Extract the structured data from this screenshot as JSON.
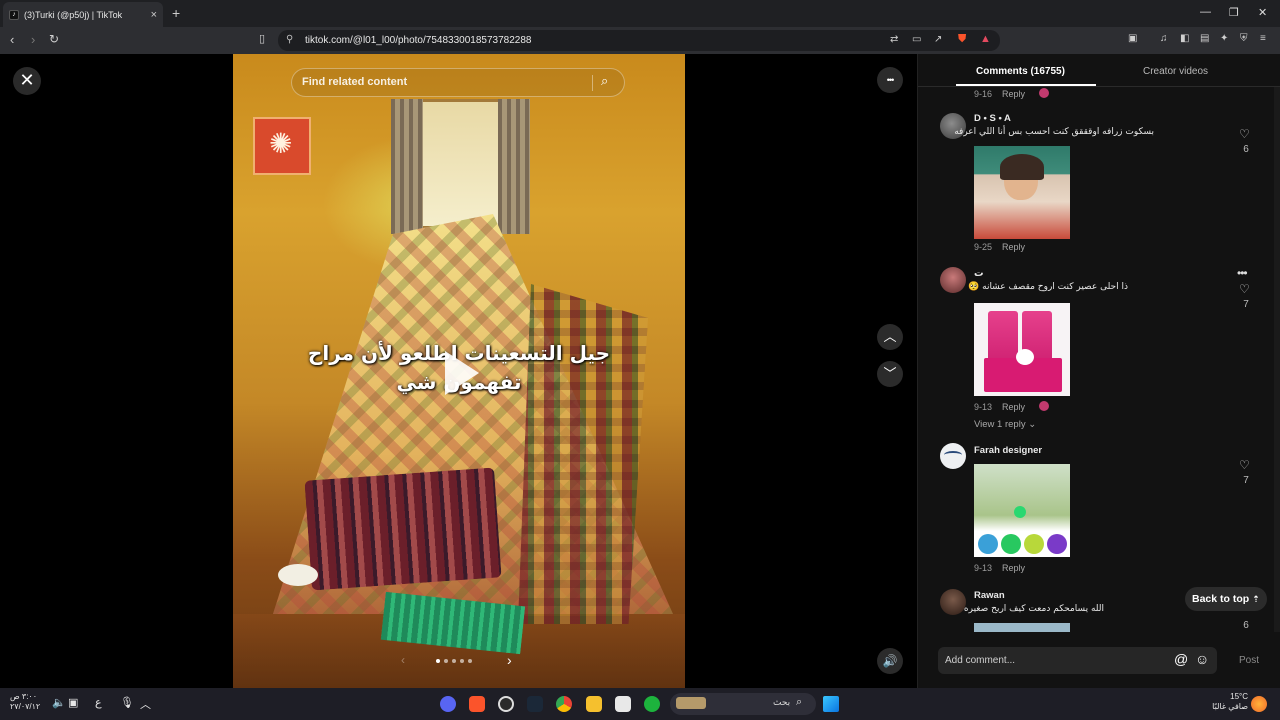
{
  "browser": {
    "tab_title": "(3)Turki (@p50j) | TikTok",
    "new_tab": "+",
    "url": "tiktok.com/@l01_l00/photo/7548330018573782288",
    "window_min": "—",
    "window_max": "❐",
    "window_close": "✕"
  },
  "viewer": {
    "close_label": "✕",
    "search_placeholder": "Find related content",
    "caption_line1": "جيل التسعينات اطلعو لأن مراح",
    "caption_line2": "تفهمون شي",
    "more_label": "•••",
    "slide_count": 5,
    "active_slide": 0
  },
  "panel": {
    "tab_comments": "Comments (16755)",
    "tab_creator": "Creator videos",
    "reply_label": "Reply",
    "top_meta": {
      "date": "9-16"
    },
    "comments": [
      {
        "user": "D • S • A",
        "text": "بسكوت زرافه اوقققق كنت احسب بس أنا اللي اعرفه",
        "date": "9-25",
        "likes": "6"
      },
      {
        "user": "ت",
        "text": "ذا احلى عصير كنت اروح مقصف عشانه 🥺",
        "date": "9-13",
        "likes": "7"
      },
      {
        "user": "Farah designer",
        "text": "",
        "date": "9-13",
        "likes": "7"
      },
      {
        "user": "Rawan",
        "text": "الله يسامحكم دمعت كيف اريح صغيره",
        "date": "",
        "likes": "6"
      }
    ],
    "view_replies": "View 1 reply",
    "back_to_top": "Back to top",
    "add_comment_placeholder": "Add comment...",
    "at_symbol": "@",
    "post_label": "Post"
  },
  "taskbar": {
    "search_text": "بحث",
    "clock_line1": "٣:٠٠ ص",
    "clock_line2": "٢٧/٠٧/١٢",
    "weather_temp": "15°C",
    "weather_desc": "صافي غالبًا",
    "lang": "ع"
  },
  "colors": {
    "accent": "#fe2c55",
    "panel_bg": "#121212",
    "taskbar_bg": "#1e1e26"
  }
}
